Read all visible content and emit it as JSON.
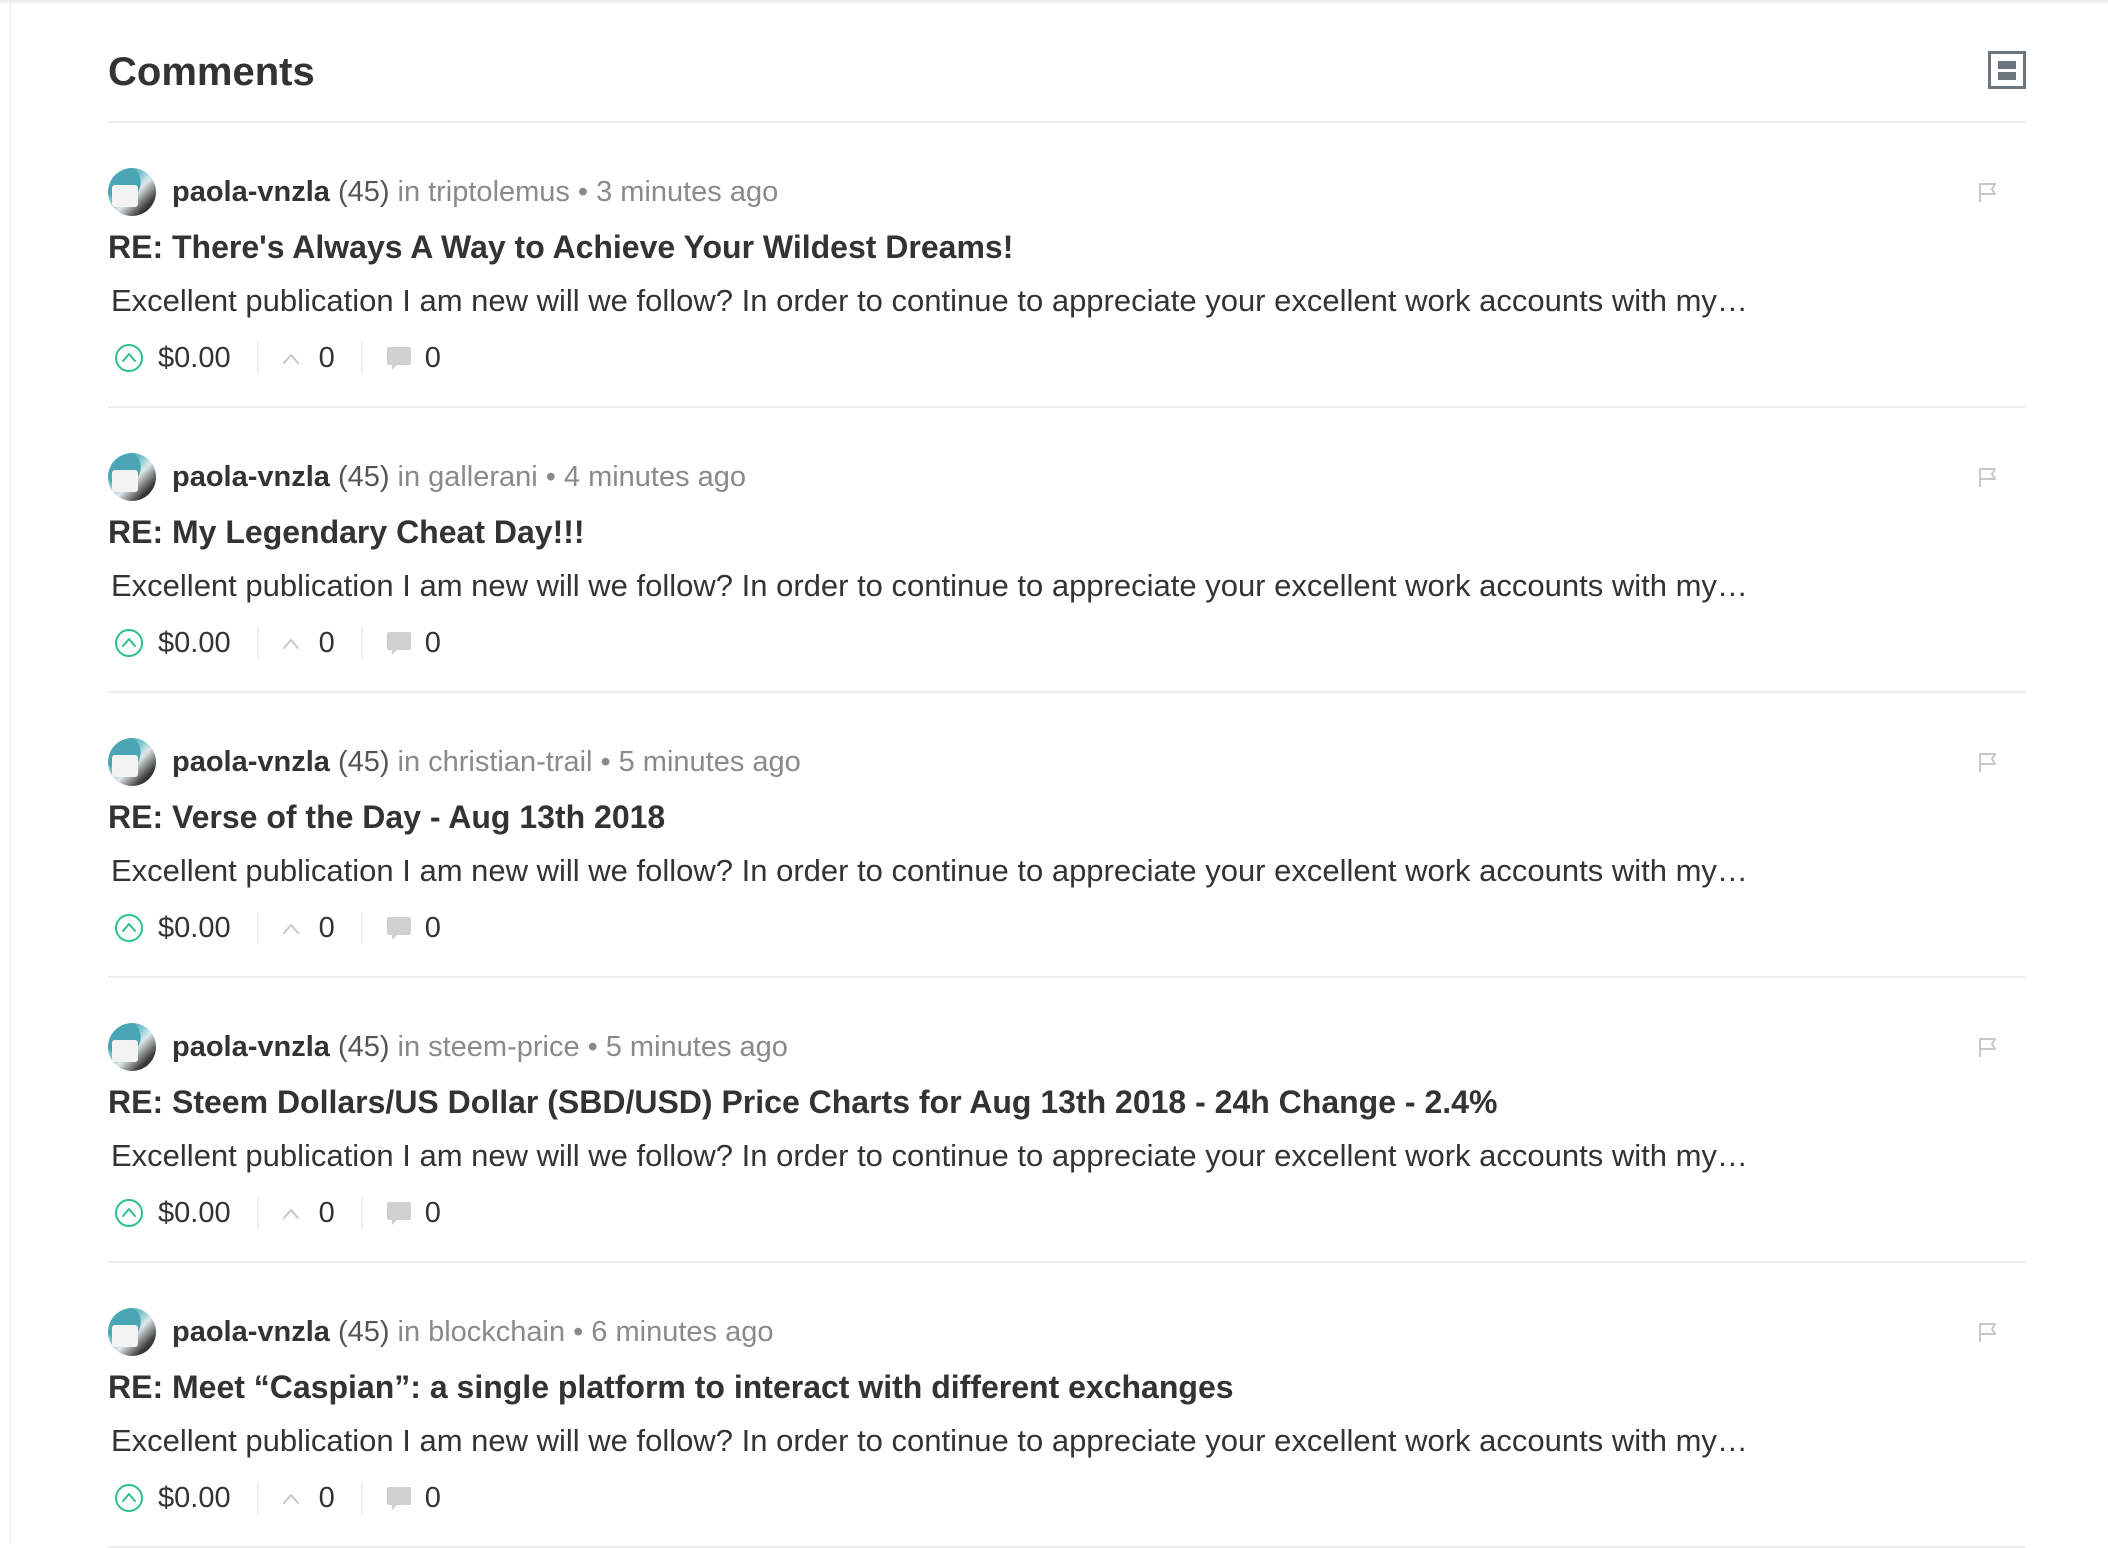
{
  "header": {
    "title": "Comments",
    "layout_icon": "list-layout-icon"
  },
  "comments": [
    {
      "author": "paola-vnzla",
      "reputation": "(45)",
      "in_label": "in",
      "category": "triptolemus",
      "separator": "•",
      "time": "3 minutes ago",
      "title": "RE: There's Always A Way to Achieve Your Wildest Dreams!",
      "body": "Excellent publication I am new will we follow? In order to continue to appreciate your excellent work accounts with my…",
      "payout": "$0.00",
      "votes": "0",
      "replies": "0"
    },
    {
      "author": "paola-vnzla",
      "reputation": "(45)",
      "in_label": "in",
      "category": "gallerani",
      "separator": "•",
      "time": "4 minutes ago",
      "title": "RE: My Legendary Cheat Day!!!",
      "body": "Excellent publication I am new will we follow? In order to continue to appreciate your excellent work accounts with my…",
      "payout": "$0.00",
      "votes": "0",
      "replies": "0"
    },
    {
      "author": "paola-vnzla",
      "reputation": "(45)",
      "in_label": "in",
      "category": "christian-trail",
      "separator": "•",
      "time": "5 minutes ago",
      "title": "RE: Verse of the Day - Aug 13th 2018",
      "body": "Excellent publication I am new will we follow? In order to continue to appreciate your excellent work accounts with my…",
      "payout": "$0.00",
      "votes": "0",
      "replies": "0"
    },
    {
      "author": "paola-vnzla",
      "reputation": "(45)",
      "in_label": "in",
      "category": "steem-price",
      "separator": "•",
      "time": "5 minutes ago",
      "title": "RE: Steem Dollars/US Dollar (SBD/USD) Price Charts for Aug 13th 2018 - 24h Change - 2.4%",
      "body": "Excellent publication I am new will we follow? In order to continue to appreciate your excellent work accounts with my…",
      "payout": "$0.00",
      "votes": "0",
      "replies": "0"
    },
    {
      "author": "paola-vnzla",
      "reputation": "(45)",
      "in_label": "in",
      "category": "blockchain",
      "separator": "•",
      "time": "6 minutes ago",
      "title": "RE: Meet “Caspian”: a single platform to interact with different exchanges",
      "body": "Excellent publication I am new will we follow? In order to continue to appreciate your excellent work accounts with my…",
      "payout": "$0.00",
      "votes": "0",
      "replies": "0"
    }
  ],
  "icons": {
    "upvote": "upvote-circle-icon",
    "votes": "chevron-up-icon",
    "replies": "speech-bubble-icon",
    "flag": "flag-icon",
    "avatar": "avatar"
  },
  "colors": {
    "upvote_green": "#2dbf8f",
    "muted_text": "#8a8a8a",
    "title_text": "#333333",
    "divider": "#eeeeee",
    "icon_gray": "#c8c8c8"
  }
}
